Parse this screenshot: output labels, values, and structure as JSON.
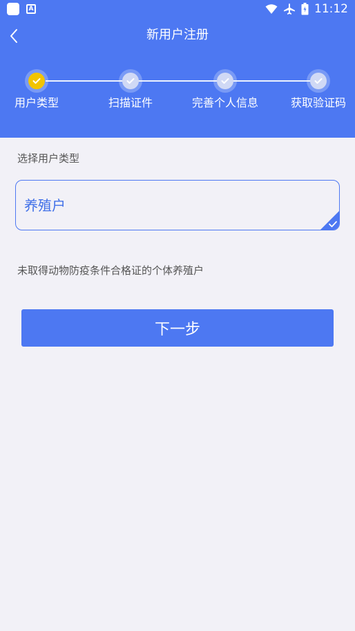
{
  "status_bar": {
    "time": "11:12",
    "a_icon_text": "A"
  },
  "header": {
    "title": "新用户注册"
  },
  "steps": [
    {
      "label": "用户类型",
      "state": "active"
    },
    {
      "label": "扫描证件",
      "state": "pending"
    },
    {
      "label": "完善个人信息",
      "state": "pending"
    },
    {
      "label": "获取验证码",
      "state": "pending"
    }
  ],
  "form": {
    "section_label": "选择用户类型",
    "selected_value": "养殖户",
    "description": "未取得动物防疫条件合格证的个体养殖户"
  },
  "next_button": {
    "label": "下一步"
  },
  "colors": {
    "primary": "#4d78f2",
    "active_step": "#f2c400",
    "background": "#f2f1f7"
  }
}
